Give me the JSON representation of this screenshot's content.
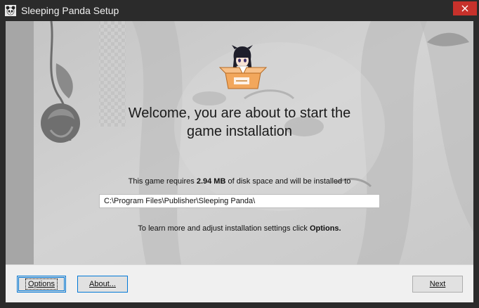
{
  "window": {
    "title": "Sleeping Panda Setup",
    "icons": {
      "app": "panda-app-icon",
      "close": "close-icon"
    }
  },
  "main": {
    "welcome_line1": "Welcome, you are about to start the",
    "welcome_line2": "game installation",
    "requires_prefix": "This game requires",
    "disk_space": "2.94 MB",
    "requires_suffix": "of disk space and will be installed to",
    "install_path": "C:\\Program Files\\Publisher\\Sleeping Panda\\",
    "learn_prefix": "To learn more and adjust installation settings click",
    "learn_link": "Options."
  },
  "footer": {
    "options_label": "Options",
    "about_label": "About...",
    "next_label": "Next"
  },
  "colors": {
    "titlebar": "#2b2b2b",
    "close": "#c7312b",
    "accent": "#0078d7",
    "content_bg": "#cdcdcd",
    "footer_bg": "#f0f0f0"
  }
}
